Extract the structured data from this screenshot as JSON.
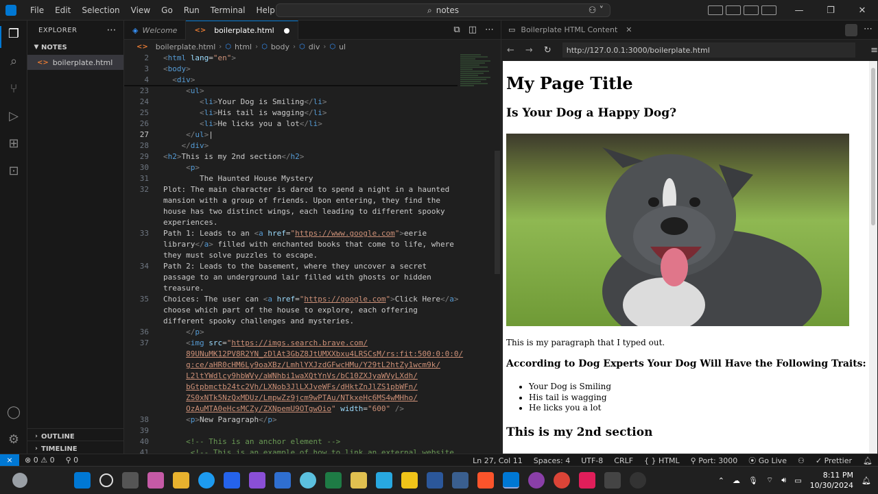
{
  "titlebar": {
    "menu": [
      "File",
      "Edit",
      "Selection",
      "View",
      "Go",
      "Run",
      "Terminal",
      "Help"
    ],
    "search_text": "notes"
  },
  "sidebar": {
    "header": "EXPLORER",
    "folder": "NOTES",
    "file": "boilerplate.html",
    "outline": "OUTLINE",
    "timeline": "TIMELINE"
  },
  "editor": {
    "tabs": [
      {
        "label": "Welcome"
      },
      {
        "label": "boilerplate.html"
      }
    ],
    "breadcrumb": [
      "boilerplate.html",
      "html",
      "body",
      "div",
      "ul"
    ]
  },
  "preview": {
    "tab_title": "Boilerplate HTML Content",
    "url": "http://127.0.0.1:3000/boilerplate.html",
    "h1": "My Page Title",
    "h2": "Is Your Dog a Happy Dog?",
    "paragraph": "This is my paragraph that I typed out.",
    "h3": "According to Dog Experts Your Dog Will Have the Following Traits:",
    "traits": [
      "Your Dog is Smiling",
      "His tail is wagging",
      "He licks you a lot"
    ],
    "h2b": "This is my 2nd section"
  },
  "statusbar": {
    "errors": "0",
    "warnings": "0",
    "ports": "0",
    "position": "Ln 27, Col 11",
    "spaces": "Spaces: 4",
    "encoding": "UTF-8",
    "eol": "CRLF",
    "language": "HTML",
    "port": "Port: 3000",
    "golive": "Go Live",
    "prettier": "Prettier"
  },
  "taskbar": {
    "time": "8:11 PM",
    "date": "10/30/2024"
  },
  "colors": {
    "accent": "#0078d4",
    "editor_bg": "#1f1f1f",
    "string": "#ce9178",
    "tag": "#569cd6",
    "attr": "#9cdcfe"
  }
}
